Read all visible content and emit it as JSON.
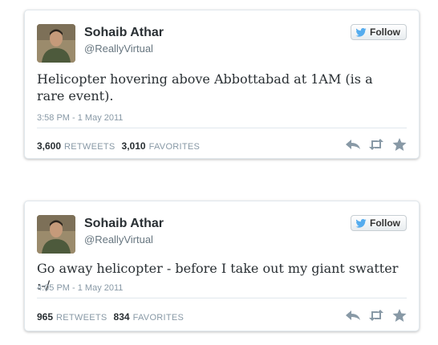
{
  "tweets": [
    {
      "name": "Sohaib Athar",
      "handle": "@ReallyVirtual",
      "follow_label": "Follow",
      "text": "Helicopter hovering above Abbottabad at 1AM (is a rare event).",
      "timestamp": "3:58 PM - 1 May 2011",
      "retweets": "3,600",
      "retweets_label": "RETWEETS",
      "favorites": "3,010",
      "favorites_label": "FAVORITES"
    },
    {
      "name": "Sohaib Athar",
      "handle": "@ReallyVirtual",
      "follow_label": "Follow",
      "text": "Go away helicopter - before I take out my giant swatter :-/",
      "timestamp": "4:05 PM - 1 May 2011",
      "retweets": "965",
      "retweets_label": "RETWEETS",
      "favorites": "834",
      "favorites_label": "FAVORITES"
    }
  ],
  "icons": {
    "follow": "twitter-bird-icon",
    "reply": "reply-icon",
    "retweet": "retweet-icon",
    "favorite": "star-icon"
  },
  "colors": {
    "brand_blue": "#55acee",
    "text": "#292f33",
    "muted": "#8899a6",
    "icon_gray": "#8899a6"
  }
}
